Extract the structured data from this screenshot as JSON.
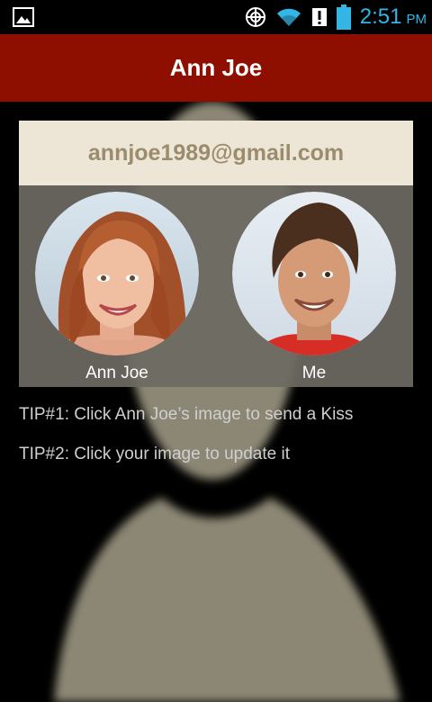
{
  "status_bar": {
    "time": "2:51",
    "ampm": "PM",
    "icons": [
      "gallery-icon",
      "sync-icon",
      "wifi-icon",
      "alert-icon",
      "battery-icon"
    ],
    "accent_color": "#33b5e5"
  },
  "action_bar": {
    "title": "Ann Joe",
    "background_color": "#8e0e00"
  },
  "card": {
    "email": "annjoe1989@gmail.com",
    "contacts": [
      {
        "name": "Ann Joe"
      },
      {
        "name": "Me"
      }
    ]
  },
  "tips": [
    "TIP#1: Click Ann Joe’s image to send a Kiss",
    "TIP#2: Click your image to update it"
  ]
}
